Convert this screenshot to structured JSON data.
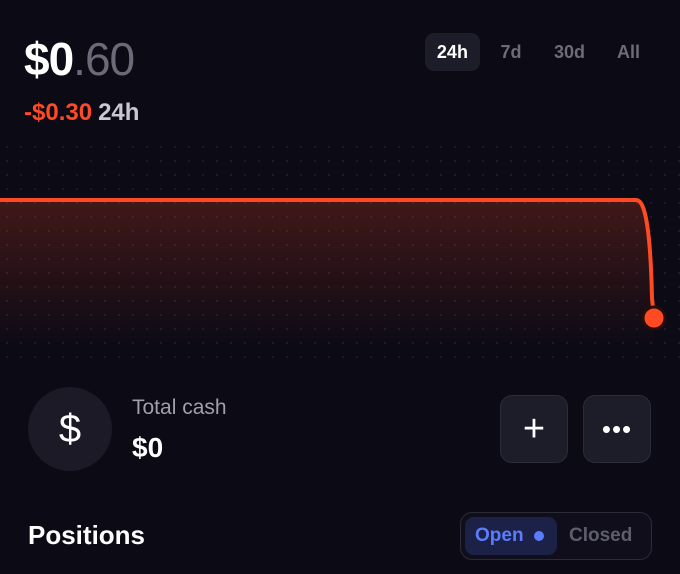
{
  "balance": {
    "whole": "$0",
    "fraction": ".60"
  },
  "change": {
    "amount": "-$0.30",
    "period": "24h"
  },
  "range_tabs": [
    {
      "label": "24h",
      "active": true
    },
    {
      "label": "7d",
      "active": false
    },
    {
      "label": "30d",
      "active": false
    },
    {
      "label": "All",
      "active": false
    }
  ],
  "chart_data": {
    "type": "line",
    "series": [
      {
        "values": [
          0.9,
          0.9,
          0.9,
          0.9,
          0.9,
          0.9,
          0.9,
          0.9,
          0.9,
          0.9,
          0.6
        ]
      }
    ],
    "line_color": "#ff4a24",
    "end_marker": true
  },
  "cash": {
    "icon": "dollar-icon",
    "label": "Total cash",
    "value": "$0"
  },
  "actions": {
    "add_icon": "plus-icon",
    "more_icon": "more-icon"
  },
  "positions": {
    "title": "Positions",
    "open_label": "Open",
    "closed_label": "Closed",
    "selected": "Open"
  },
  "colors": {
    "accent": "#5b7cff",
    "negative": "#ff4a24",
    "background": "#0b0a15"
  }
}
